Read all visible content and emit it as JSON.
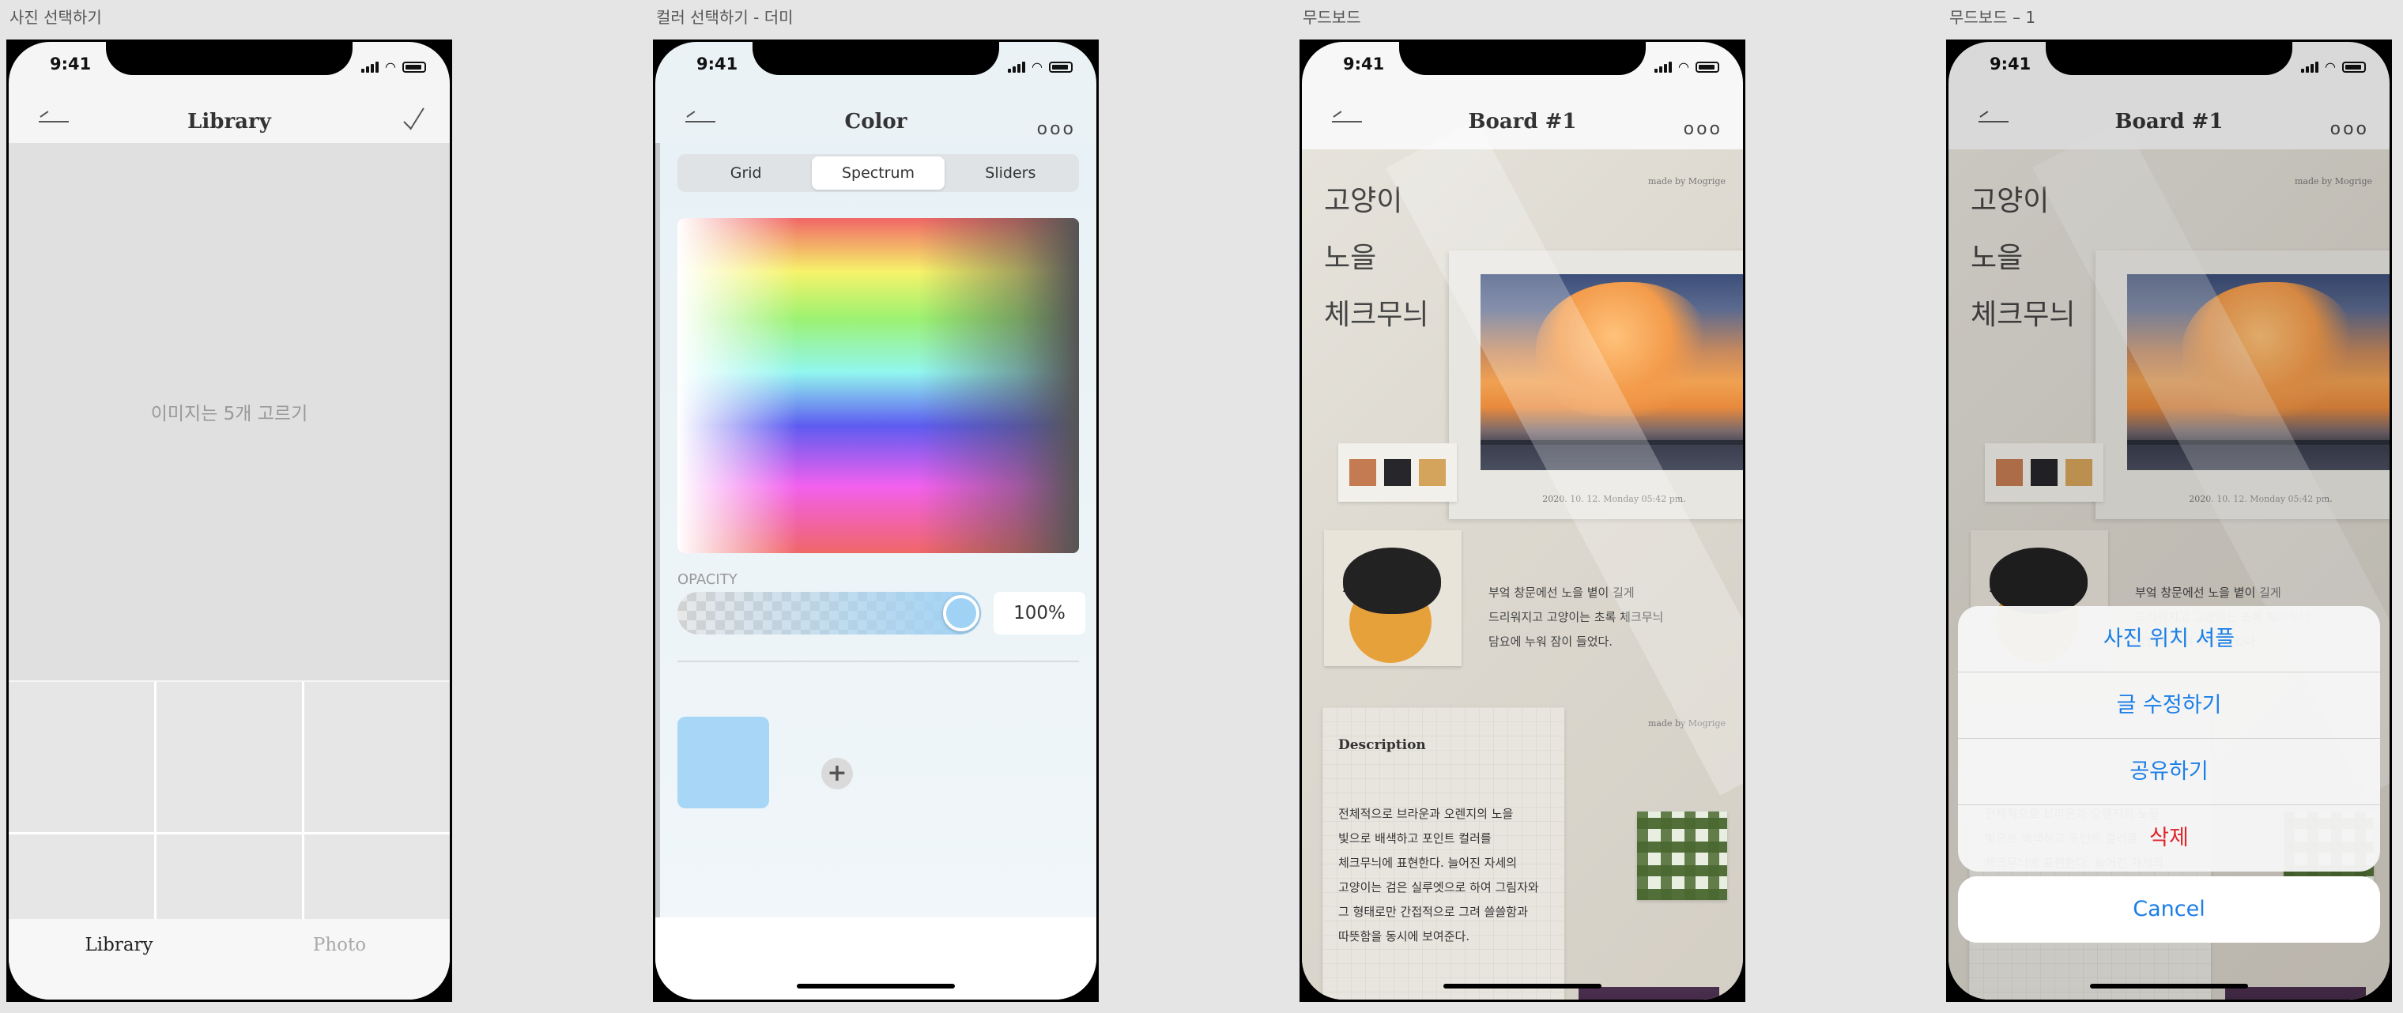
{
  "frames": [
    {
      "title": "사진 선택하기"
    },
    {
      "title": "컬러 선택하기 - 더미"
    },
    {
      "title": "무드보드"
    },
    {
      "title": "무드보드 – 1"
    }
  ],
  "status_time": "9:41",
  "library": {
    "title": "Library",
    "placeholder_text": "이미지는 5개 고르기",
    "tabs": [
      "Library",
      "Photo"
    ]
  },
  "color": {
    "title": "Color",
    "more": "ooo",
    "segments": [
      "Grid",
      "Spectrum",
      "Sliders"
    ],
    "selected_segment": "Spectrum",
    "opacity_label": "OPACITY",
    "opacity_value": "100%",
    "opacity_fraction": 1.0,
    "selected_color": "#a8d6f6",
    "add_symbol": "+"
  },
  "board": {
    "title": "Board #1",
    "more": "ooo",
    "words": [
      "고양이",
      "노을",
      "체크무늬"
    ],
    "made_by": "made by Mogrige",
    "date": "2020. 10. 12. Monday 05:42 pm.",
    "palette": [
      "#c57b52",
      "#26262b",
      "#d4a35c"
    ],
    "poem": [
      "부엌 창문에선 노을 볕이 길게",
      "드리워지고 고양이는 초록 체크무늬",
      "담요에 누워 잠이 들었다."
    ],
    "description_title": "Description",
    "description_lines": [
      "전체적으로 브라운과 오렌지의 노을",
      "빛으로 배색하고 포인트 컬러를",
      "체크무늬에 표현한다. 늘어진 자세의",
      "고양이는 검은 실루엣으로 하여 그림자와",
      "그 형태로만 간접적으로 그려 쓸쓸함과",
      "따뜻함을 동시에 보여준다."
    ]
  },
  "action_sheet": {
    "items": [
      "사진 위치 셔플",
      "글 수정하기",
      "공유하기",
      "삭제"
    ],
    "cancel": "Cancel",
    "accent_color": "#1a7ee6",
    "danger_color": "#e0242b"
  }
}
